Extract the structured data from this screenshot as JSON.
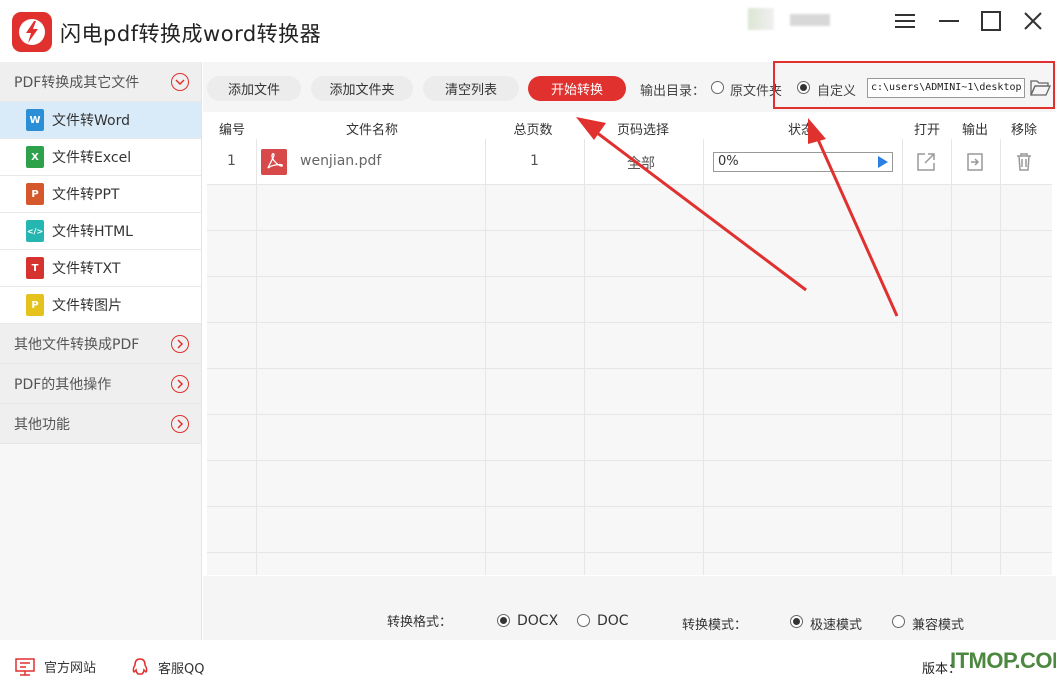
{
  "window": {
    "title": "闪电pdf转换成word转换器"
  },
  "sidebar": {
    "groups": [
      {
        "label": "PDF转换成其它文件",
        "expanded": true,
        "items": [
          {
            "label": "文件转Word",
            "icon": "W",
            "color": "#2a8fd6",
            "active": true
          },
          {
            "label": "文件转Excel",
            "icon": "X",
            "color": "#2ea24b",
            "active": false
          },
          {
            "label": "文件转PPT",
            "icon": "P",
            "color": "#d5572c",
            "active": false
          },
          {
            "label": "文件转HTML",
            "icon": "</>",
            "color": "#26b6b1",
            "active": false
          },
          {
            "label": "文件转TXT",
            "icon": "T",
            "color": "#d6322f",
            "active": false
          },
          {
            "label": "文件转图片",
            "icon": "P",
            "color": "#e6c21c",
            "active": false
          }
        ]
      },
      {
        "label": "其他文件转换成PDF",
        "expanded": false
      },
      {
        "label": "PDF的其他操作",
        "expanded": false
      },
      {
        "label": "其他功能",
        "expanded": false
      }
    ]
  },
  "toolbar": {
    "add_file": "添加文件",
    "add_folder": "添加文件夹",
    "clear_list": "清空列表",
    "start_convert": "开始转换",
    "output_dir_label": "输出目录：",
    "original_folder": "原文件夹",
    "custom": "自定义",
    "output_path": "c:\\users\\ADMINI~1\\desktop",
    "selected_output": "custom"
  },
  "table": {
    "headers": [
      "编号",
      "文件名称",
      "总页数",
      "页码选择",
      "状态",
      "打开",
      "输出",
      "移除"
    ],
    "rows": [
      {
        "index": "1",
        "filename": "wenjian.pdf",
        "pages": "1",
        "page_selection": "全部",
        "status": "0%"
      }
    ]
  },
  "options": {
    "format_label": "转换格式：",
    "format_docx": "DOCX",
    "format_doc": "DOC",
    "selected_format": "DOCX",
    "mode_label": "转换模式：",
    "mode_fast": "极速模式",
    "mode_compat": "兼容模式",
    "selected_mode": "极速模式"
  },
  "footer": {
    "website": "官方网站",
    "qq": "客服QQ",
    "version": "版本：",
    "watermark": "ITMOP.COM"
  },
  "colors": {
    "accent": "#e0312f",
    "active_item_bg": "#d9ebf9",
    "play_blue": "#2a7fe0"
  }
}
